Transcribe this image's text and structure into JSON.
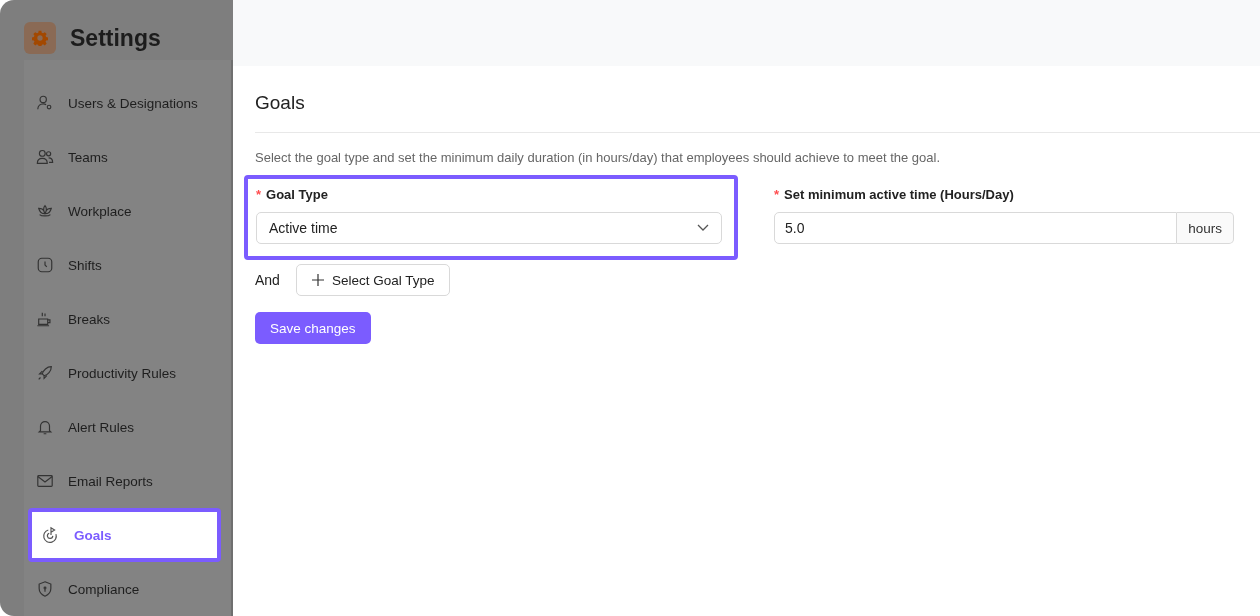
{
  "sidebar": {
    "title": "Settings",
    "items": [
      {
        "label": "Users & Designations",
        "kind": "users",
        "selected": false
      },
      {
        "label": "Teams",
        "kind": "teams",
        "selected": false
      },
      {
        "label": "Workplace",
        "kind": "workplace",
        "selected": false
      },
      {
        "label": "Shifts",
        "kind": "shifts",
        "selected": false
      },
      {
        "label": "Breaks",
        "kind": "breaks",
        "selected": false
      },
      {
        "label": "Productivity Rules",
        "kind": "rocket",
        "selected": false
      },
      {
        "label": "Alert Rules",
        "kind": "bell",
        "selected": false
      },
      {
        "label": "Email Reports",
        "kind": "mail",
        "selected": false
      },
      {
        "label": "Goals",
        "kind": "goals",
        "selected": true
      },
      {
        "label": "Compliance",
        "kind": "shield",
        "selected": false
      }
    ]
  },
  "page": {
    "title": "Goals",
    "description": "Select the goal type and set the minimum daily duration (in hours/day) that employees should achieve to meet the goal.",
    "goal_type": {
      "marker": "*",
      "label": "Goal Type",
      "value": "Active time",
      "highlighted": true
    },
    "min_time": {
      "marker": "*",
      "label": "Set minimum active time (Hours/Day)",
      "value": "5.0",
      "suffix": "hours"
    },
    "and_label": "And",
    "add_button": "Select Goal Type",
    "save_button": "Save changes"
  }
}
